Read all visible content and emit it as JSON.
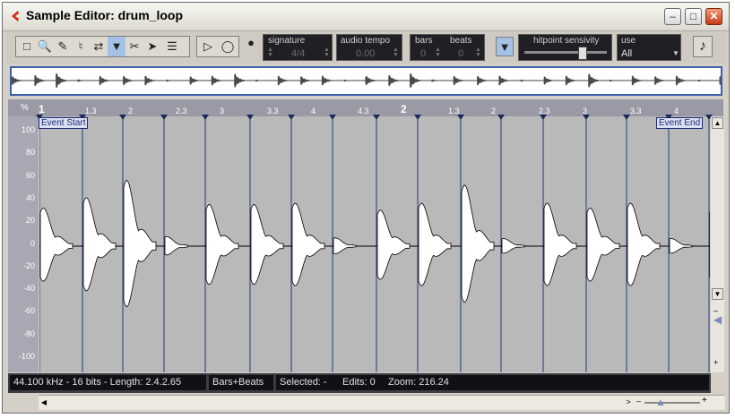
{
  "window": {
    "title": "Sample Editor: drum_loop",
    "minimize_label": "–",
    "maximize_label": "□",
    "close_label": "✕"
  },
  "toolbar": {
    "signature": {
      "label": "signature",
      "value": "4/4"
    },
    "tempo": {
      "label": "audio tempo",
      "value": "0.00"
    },
    "bars": {
      "label": "bars",
      "value": "0"
    },
    "beats": {
      "label": "beats",
      "value": "0"
    },
    "hitpoint_sensitivity": {
      "label": "hitpoint sensivity",
      "level": 0.72
    },
    "use": {
      "label": "use",
      "value": "All"
    }
  },
  "ruler": {
    "percent_label": "%",
    "ticks": [
      "1",
      "1.3",
      "2",
      "2.3",
      "3",
      "3.3",
      "4",
      "4.3",
      "2",
      "1.3",
      "2",
      "2.3",
      "3",
      "3.3",
      "4"
    ]
  },
  "markers": {
    "event_start": "Event Start",
    "event_end": "Event End"
  },
  "y_axis": [
    "100",
    "80",
    "60",
    "40",
    "20",
    "0",
    "-20",
    "-40",
    "-60",
    "-80",
    "-100"
  ],
  "status": {
    "format": "44.100 kHz - 16 bits - Length: 2.4.2.65",
    "ruler_mode": "Bars+Beats",
    "selected": "Selected: -",
    "edits": "Edits: 0",
    "zoom": "Zoom: 216.24"
  },
  "icons": [
    "range-select-icon",
    "zoom-icon",
    "pencil-icon",
    "speaker-icon",
    "loop-icon",
    "hitpoint-edit-icon",
    "scissors-icon",
    "pointer-icon",
    "grid-icon",
    "play-icon",
    "loop-region-icon",
    "metronome-icon",
    "note-icon"
  ]
}
